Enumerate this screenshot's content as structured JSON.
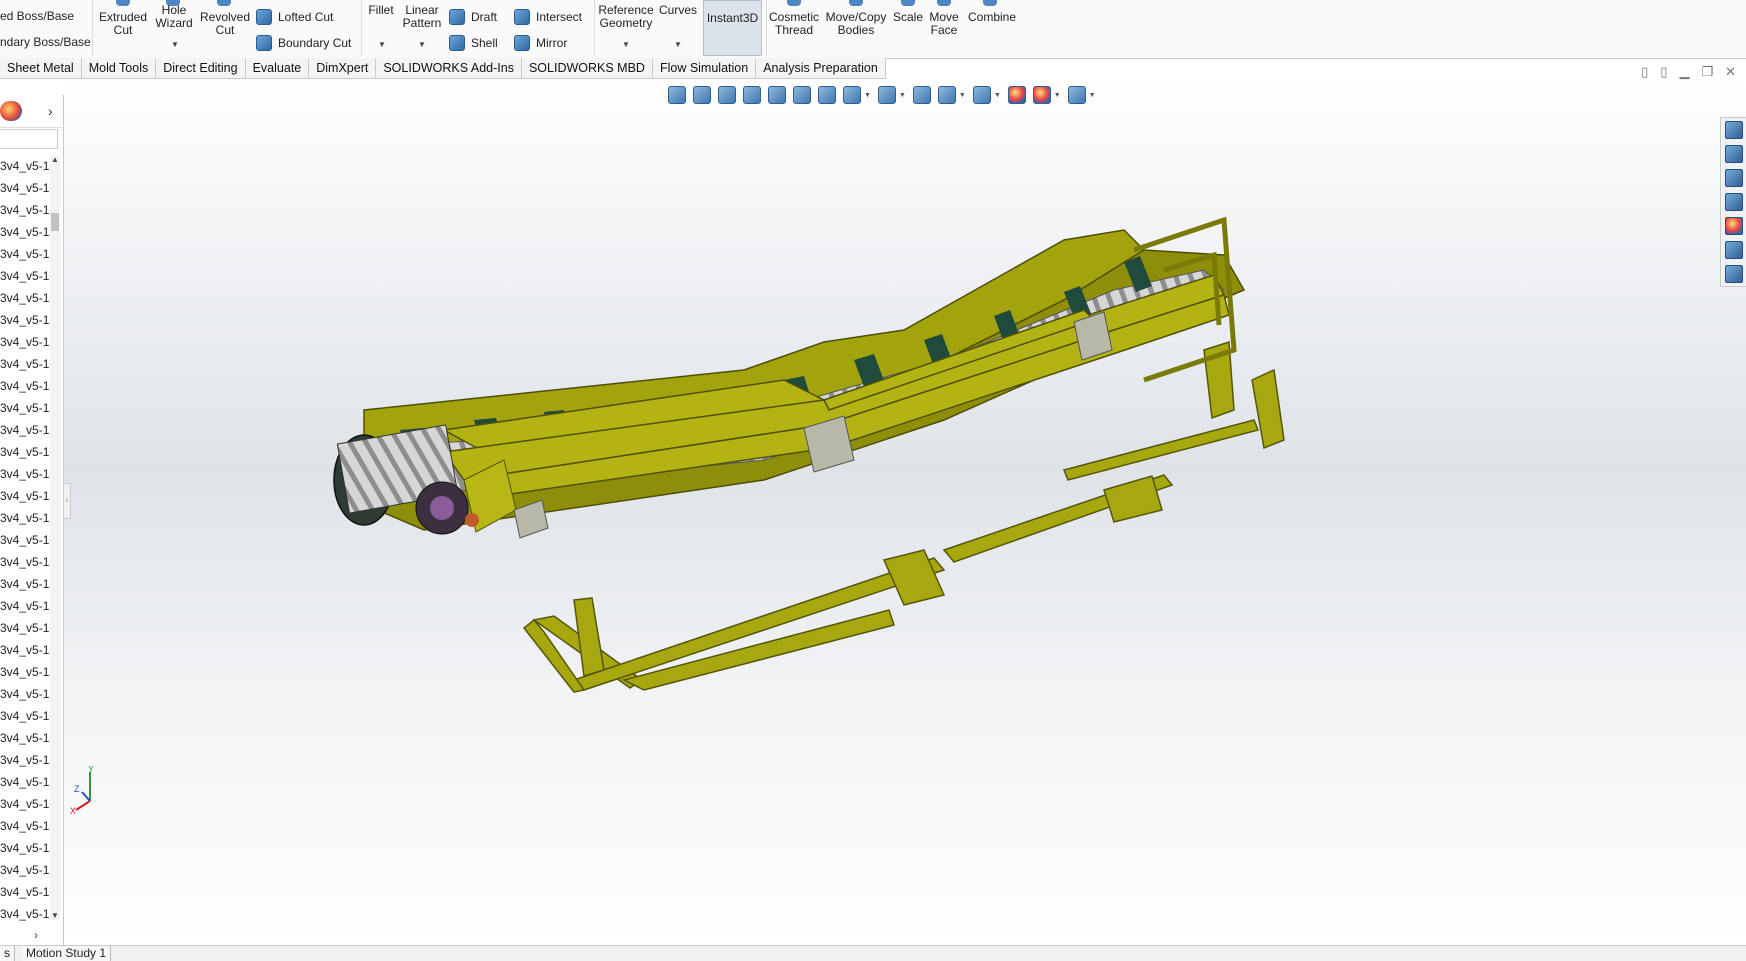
{
  "ribbon": {
    "boss_base_partial": "ed Boss/Base",
    "boundary_boss_partial": "ndary Boss/Base",
    "extruded_cut": [
      "Extruded",
      "Cut"
    ],
    "hole_wizard": [
      "Hole",
      "Wizard"
    ],
    "revolved_cut": [
      "Revolved",
      "Cut"
    ],
    "lofted_cut": "Lofted Cut",
    "boundary_cut": "Boundary Cut",
    "fillet": "Fillet",
    "linear_pattern": [
      "Linear",
      "Pattern"
    ],
    "draft": "Draft",
    "shell": "Shell",
    "intersect": "Intersect",
    "mirror": "Mirror",
    "reference_geometry": [
      "Reference",
      "Geometry"
    ],
    "curves": "Curves",
    "instant3d": "Instant3D",
    "cosmetic_thread": [
      "Cosmetic",
      "Thread"
    ],
    "move_copy_bodies": [
      "Move/Copy",
      "Bodies"
    ],
    "scale": "Scale",
    "move_face": [
      "Move",
      "Face"
    ],
    "combine": "Combine"
  },
  "tabs": [
    "Sheet Metal",
    "Mold Tools",
    "Direct Editing",
    "Evaluate",
    "DimXpert",
    "SOLIDWORKS Add-Ins",
    "SOLIDWORKS MBD",
    "Flow Simulation",
    "Analysis Preparation"
  ],
  "tree": {
    "items": [
      "3v4_v5-1-",
      "3v4_v5-1-",
      "3v4_v5-1-",
      "3v4_v5-1-",
      "3v4_v5-1-",
      "3v4_v5-1-",
      "3v4_v5-1-",
      "3v4_v5-1-",
      "3v4_v5-1-",
      "3v4_v5-1-",
      "3v4_v5-1-",
      "3v4_v5-1-",
      "3v4_v5-1-",
      "3v4_v5-1-",
      "3v4_v5-1-",
      "3v4_v5-1-",
      "3v4_v5-1-",
      "3v4_v5-1-",
      "3v4_v5-1-",
      "3v4_v5-1-",
      "3v4_v5-1-",
      "3v4_v5-1-",
      "3v4_v5-1-",
      "3v4_v5-1-",
      "3v4_v5-1-",
      "3v4_v5-1-",
      "3v4_v5-1-",
      "3v4_v5-1-",
      "3v4_v5-1-",
      "3v4_v5-1-",
      "3v4_v5-1-",
      "3v4_v5-1-",
      "3v4_v5-1-",
      "3v4_v5-1-",
      "3v4_v5-1-"
    ]
  },
  "triad": {
    "x": "X",
    "y": "Y",
    "z": "Z"
  },
  "bottom_tabs": [
    "s",
    "Motion Study 1"
  ],
  "colors": {
    "model": "#9c9c0c",
    "model_dark": "#6f6f05",
    "belt": "#1f4a3c",
    "roller": "#c9c9c9",
    "accent": "#2d6aa6"
  }
}
